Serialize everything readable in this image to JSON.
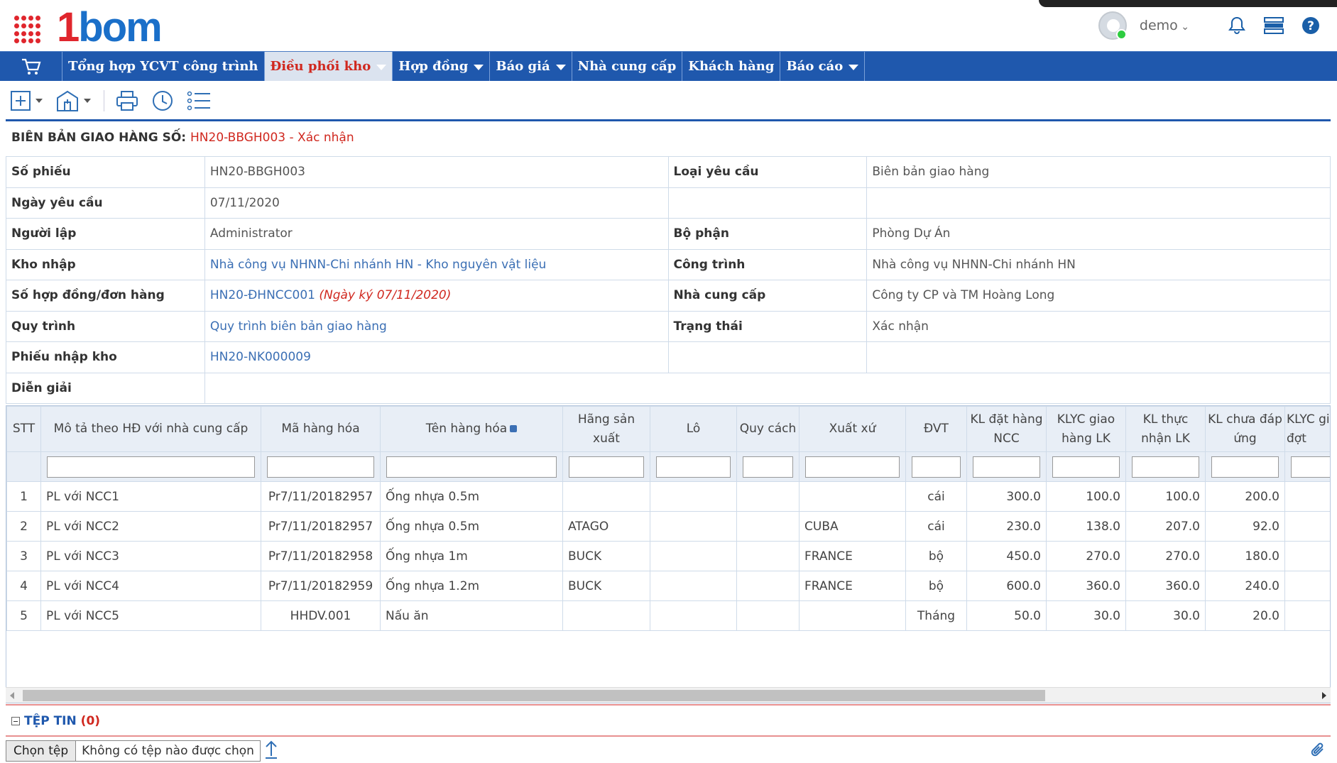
{
  "header": {
    "logo_part1": "1",
    "logo_part2": "bom",
    "username": "demo"
  },
  "nav": {
    "items": [
      {
        "label": "Tổng hợp YCVT công trình",
        "has_dropdown": false
      },
      {
        "label": "Điều phối kho",
        "has_dropdown": true,
        "active": true
      },
      {
        "label": "Hợp đồng",
        "has_dropdown": true
      },
      {
        "label": "Báo giá",
        "has_dropdown": true
      },
      {
        "label": "Nhà cung cấp",
        "has_dropdown": false
      },
      {
        "label": "Khách hàng",
        "has_dropdown": false
      },
      {
        "label": "Báo cáo",
        "has_dropdown": true
      }
    ]
  },
  "toolbar": {
    "icons": [
      "plus-icon",
      "building-icon",
      "print-icon",
      "history-icon",
      "list-icon"
    ]
  },
  "doc": {
    "title_prefix": "BIÊN BẢN GIAO HÀNG SỐ:",
    "title_code": "HN20-BBGH003 - Xác nhận"
  },
  "info": {
    "so_phieu_label": "Số phiếu",
    "so_phieu": "HN20-BBGH003",
    "loai_yc_label": "Loại yêu cầu",
    "loai_yc": "Biên bản giao hàng",
    "ngay_yc_label": "Ngày yêu cầu",
    "ngay_yc": "07/11/2020",
    "nguoi_lap_label": "Người lập",
    "nguoi_lap": "Administrator",
    "bo_phan_label": "Bộ phận",
    "bo_phan": "Phòng Dự Án",
    "kho_nhap_label": "Kho nhập",
    "kho_nhap": "Nhà công vụ NHNN-Chi nhánh HN - Kho nguyên vật liệu",
    "cong_trinh_label": "Công trình",
    "cong_trinh": "Nhà công vụ NHNN-Chi nhánh HN",
    "so_hd_label": "Số hợp đồng/đơn hàng",
    "so_hd": "HN20-ĐHNCC001",
    "ngay_ky": "(Ngày ký 07/11/2020)",
    "ncc_label": "Nhà cung cấp",
    "ncc": "Công ty CP và TM Hoàng Long",
    "quy_trinh_label": "Quy trình",
    "quy_trinh": "Quy trình biên bản giao hàng",
    "trang_thai_label": "Trạng thái",
    "trang_thai": "Xác nhận",
    "phieu_nk_label": "Phiếu nhập kho",
    "phieu_nk": "HN20-NK000009",
    "dien_giai_label": "Diễn giải",
    "dien_giai": ""
  },
  "grid": {
    "headers": {
      "stt": "STT",
      "mo_ta": "Mô tả theo HĐ với nhà cung cấp",
      "ma_hh": "Mã hàng hóa",
      "ten_hh": "Tên hàng hóa",
      "hang_sx": "Hãng sản xuất",
      "lo": "Lô",
      "quy_cach": "Quy cách",
      "xuat_xu": "Xuất xứ",
      "dvt": "ĐVT",
      "kl_dat": "KL đặt hàng NCC",
      "klyc_giao": "KLYC giao hàng LK",
      "kl_thuc": "KL thực nhận LK",
      "kl_chua": "KL chưa đáp ứng",
      "klyc_gi": "KLYC gi đợt"
    },
    "rows": [
      {
        "stt": "1",
        "mo_ta": "PL với NCC1",
        "ma_hh": "Pr7/11/20182957",
        "ten_hh": "Ống nhựa 0.5m",
        "hang_sx": "",
        "lo": "",
        "quy_cach": "",
        "xuat_xu": "",
        "dvt": "cái",
        "kl_dat": "300.0",
        "klyc_giao": "100.0",
        "kl_thuc": "100.0",
        "kl_chua": "200.0"
      },
      {
        "stt": "2",
        "mo_ta": "PL với NCC2",
        "ma_hh": "Pr7/11/20182957",
        "ten_hh": "Ống nhựa 0.5m",
        "hang_sx": "ATAGO",
        "lo": "",
        "quy_cach": "",
        "xuat_xu": "CUBA",
        "dvt": "cái",
        "kl_dat": "230.0",
        "klyc_giao": "138.0",
        "kl_thuc": "207.0",
        "kl_chua": "92.0"
      },
      {
        "stt": "3",
        "mo_ta": "PL với NCC3",
        "ma_hh": "Pr7/11/20182958",
        "ten_hh": "Ống nhựa 1m",
        "hang_sx": "BUCK",
        "lo": "",
        "quy_cach": "",
        "xuat_xu": "FRANCE",
        "dvt": "bộ",
        "kl_dat": "450.0",
        "klyc_giao": "270.0",
        "kl_thuc": "270.0",
        "kl_chua": "180.0"
      },
      {
        "stt": "4",
        "mo_ta": "PL với NCC4",
        "ma_hh": "Pr7/11/20182959",
        "ten_hh": "Ống nhựa 1.2m",
        "hang_sx": "BUCK",
        "lo": "",
        "quy_cach": "",
        "xuat_xu": "FRANCE",
        "dvt": "bộ",
        "kl_dat": "600.0",
        "klyc_giao": "360.0",
        "kl_thuc": "360.0",
        "kl_chua": "240.0"
      },
      {
        "stt": "5",
        "mo_ta": "PL với NCC5",
        "ma_hh": "HHDV.001",
        "ten_hh": "Nấu ăn",
        "hang_sx": "",
        "lo": "",
        "quy_cach": "",
        "xuat_xu": "",
        "dvt": "Tháng",
        "kl_dat": "50.0",
        "klyc_giao": "30.0",
        "kl_thuc": "30.0",
        "kl_chua": "20.0"
      }
    ]
  },
  "files": {
    "title": "TỆP TIN",
    "count": "(0)",
    "choose_label": "Chọn tệp",
    "no_file_text": "Không có tệp nào được chọn"
  },
  "colors": {
    "nav_bg": "#1f58ad",
    "accent_red": "#d0281f",
    "link_blue": "#3b6fb4"
  }
}
